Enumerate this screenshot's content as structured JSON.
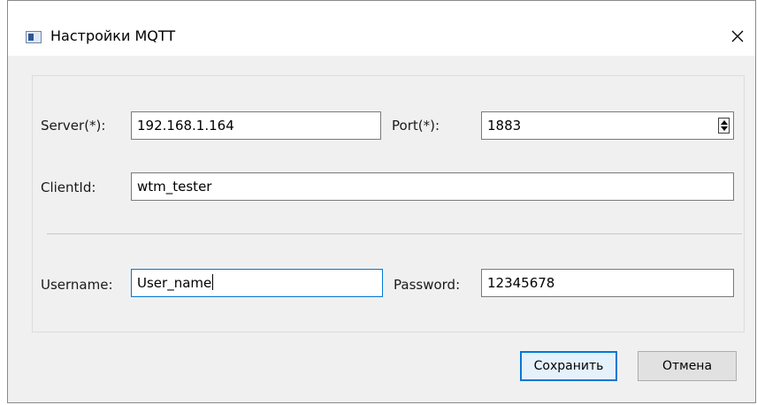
{
  "window": {
    "title": "Настройки MQTT",
    "icon": "app-window-icon",
    "close_icon": "close-icon"
  },
  "form": {
    "server_label": "Server(*):",
    "server_value": "192.168.1.164",
    "port_label": "Port(*):",
    "port_value": "1883",
    "clientid_label": "ClientId:",
    "clientid_value": "wtm_tester",
    "username_label": "Username:",
    "username_value": "User_name",
    "password_label": "Password:",
    "password_value": "12345678"
  },
  "buttons": {
    "save_label": "Сохранить",
    "cancel_label": "Отмена"
  },
  "colors": {
    "focus": "#0078d7",
    "window_bg": "#f0f0f0"
  }
}
